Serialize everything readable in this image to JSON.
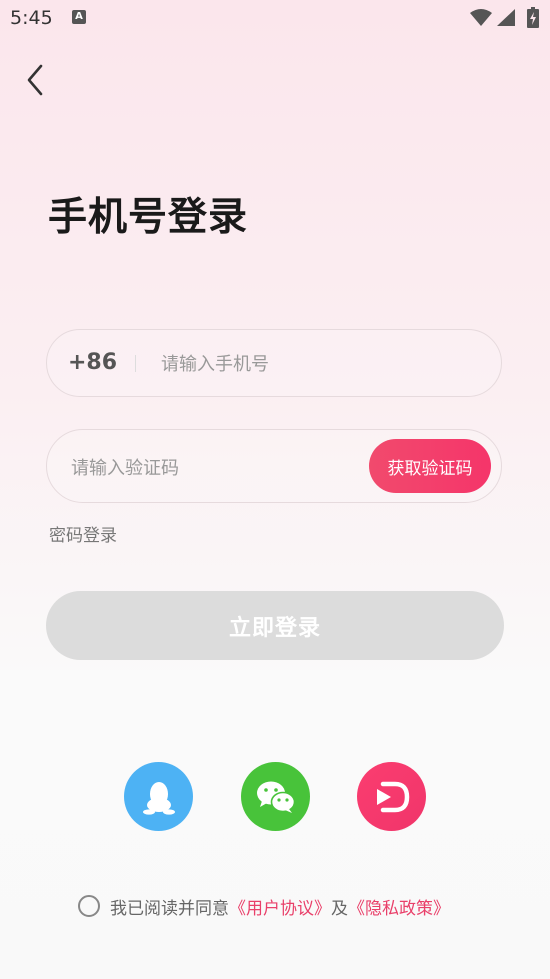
{
  "status_bar": {
    "time": "5:45",
    "notification_badge": "A",
    "icons": [
      "notification-a-icon",
      "wifi-icon",
      "signal-icon",
      "battery-charging-icon"
    ]
  },
  "nav": {
    "back_icon": "chevron-left-icon"
  },
  "title": "手机号登录",
  "phone": {
    "country_code": "+86",
    "placeholder": "请输入手机号",
    "value": ""
  },
  "verify": {
    "placeholder": "请输入验证码",
    "value": "",
    "get_code_label": "获取验证码"
  },
  "password_login_label": "密码登录",
  "login_button_label": "立即登录",
  "social": [
    {
      "name": "qq",
      "icon": "qq-penguin-icon",
      "color": "#4db2f4"
    },
    {
      "name": "wechat",
      "icon": "wechat-icon",
      "color": "#48c33a"
    },
    {
      "name": "douyin",
      "icon": "douyin-d-icon",
      "color": "#f5356a"
    }
  ],
  "agreement": {
    "prefix": "我已阅读并同意",
    "user_agreement": "《用户协议》",
    "conjunction": "及",
    "privacy_policy": "《隐私政策》"
  },
  "colors": {
    "accent": "#f5356a",
    "disabled_button": "#dcdcdc",
    "link": "#e9406a"
  }
}
